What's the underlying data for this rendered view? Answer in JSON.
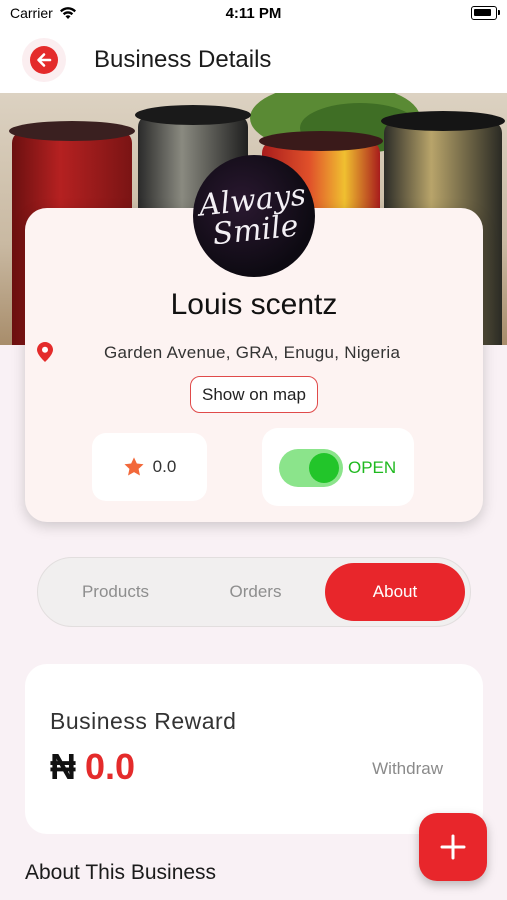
{
  "status_bar": {
    "carrier": "Carrier",
    "time": "4:11 PM"
  },
  "header": {
    "title": "Business Details"
  },
  "business": {
    "name": "Louis scentz",
    "logo_text": "Always Smile",
    "address": "Garden Avenue, GRA, Enugu, Nigeria",
    "show_map_label": "Show on map",
    "rating": "0.0",
    "status_label": "OPEN",
    "status_open": true
  },
  "tabs": [
    {
      "label": "Products",
      "active": false
    },
    {
      "label": "Orders",
      "active": false
    },
    {
      "label": "About",
      "active": true
    }
  ],
  "reward": {
    "title": "Business Reward",
    "currency_symbol": "₦",
    "amount": "0.0",
    "withdraw_label": "Withdraw"
  },
  "about": {
    "heading": "About This Business"
  },
  "colors": {
    "accent": "#e8262b",
    "open_green": "#22c52a",
    "background": "#f9f1f5",
    "star": "#f2683a"
  },
  "icons": {
    "back": "arrow-left-icon",
    "location": "map-pin-icon",
    "rating": "star-icon",
    "add": "plus-icon",
    "signal": "wifi-icon",
    "battery": "battery-icon"
  }
}
